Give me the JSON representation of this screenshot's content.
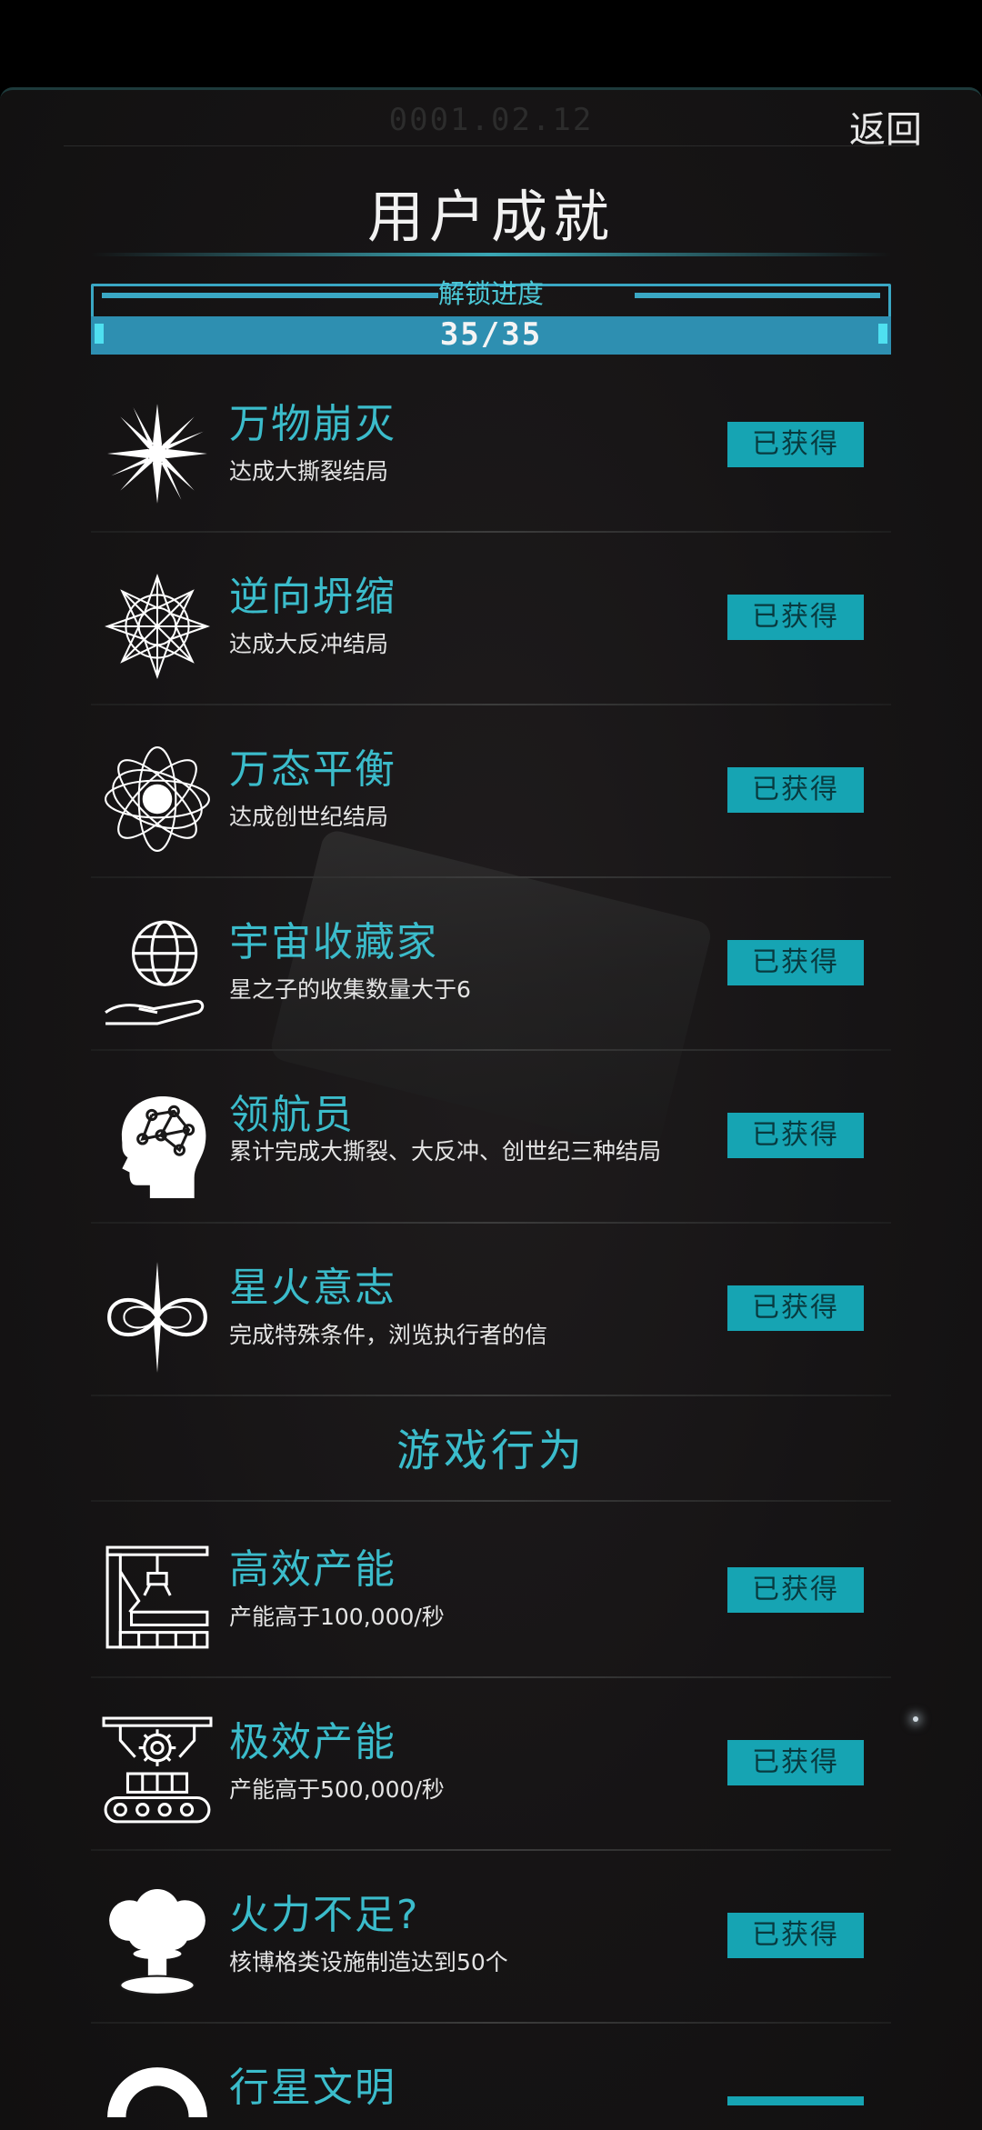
{
  "header": {
    "date": "0001.02.12",
    "back_label": "返回",
    "title": "用户成就"
  },
  "progress": {
    "label": "解锁进度",
    "value": "35/35",
    "fraction": 1.0
  },
  "achievements": [
    {
      "name": "万物崩灭",
      "desc": "达成大撕裂结局",
      "status": "已获得",
      "icon": "starburst-icon"
    },
    {
      "name": "逆向坍缩",
      "desc": "达成大反冲结局",
      "status": "已获得",
      "icon": "crystal-flower-icon"
    },
    {
      "name": "万态平衡",
      "desc": "达成创世纪结局",
      "status": "已获得",
      "icon": "atom-orbit-icon"
    },
    {
      "name": "宇宙收藏家",
      "desc": "星之子的收集数量大于6",
      "status": "已获得",
      "icon": "hand-globe-icon"
    },
    {
      "name": "领航员",
      "desc": "累计完成大撕裂、大反冲、创世纪三种结局",
      "status": "已获得",
      "icon": "brain-head-icon"
    },
    {
      "name": "星火意志",
      "desc": "完成特殊条件，浏览执行者的信",
      "status": "已获得",
      "icon": "infinity-spark-icon"
    }
  ],
  "section_title": "游戏行为",
  "behaviors": [
    {
      "name": "高效产能",
      "desc": "产能高于100,000/秒",
      "status": "已获得",
      "icon": "factory-arm-icon"
    },
    {
      "name": "极效产能",
      "desc": "产能高于500,000/秒",
      "status": "已获得",
      "icon": "gear-conveyor-icon"
    },
    {
      "name": "火力不足?",
      "desc": "核博格类设施制造达到50个",
      "status": "已获得",
      "icon": "mushroom-cloud-icon"
    },
    {
      "name": "行星文明",
      "icon": "planet-ring-icon"
    }
  ],
  "colors": {
    "accent": "#3bbccb",
    "button": "#16a4b3",
    "progress": "#2e8fb1"
  }
}
